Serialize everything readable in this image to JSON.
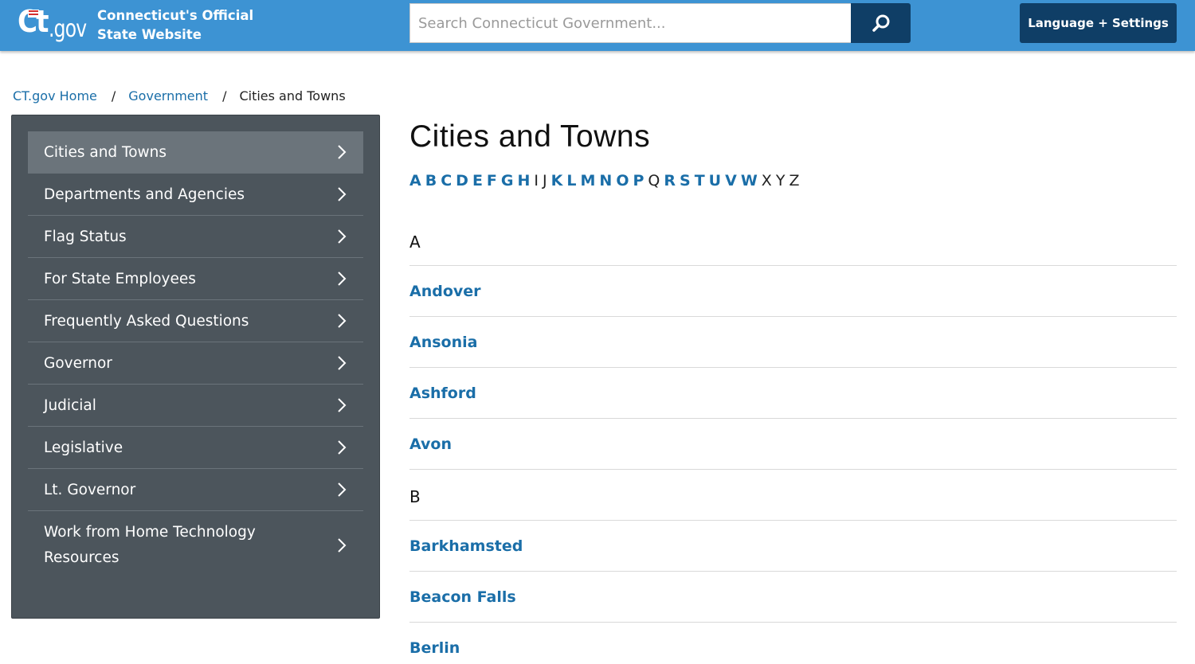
{
  "header": {
    "logo_ct": "Ct",
    "logo_gov": ".gov",
    "site_title_line1": "Connecticut's Official",
    "site_title_line2": "State Website",
    "search_placeholder": "Search Connecticut Government...",
    "search_icon": "search-icon",
    "language_button": "Language + Settings"
  },
  "breadcrumb": [
    {
      "label": "CT.gov Home"
    },
    {
      "label": "Government"
    },
    {
      "label": "Cities and Towns"
    }
  ],
  "breadcrumb_separator": "/",
  "sidebar": {
    "items": [
      {
        "label": "Cities and Towns"
      },
      {
        "label": "Departments and Agencies"
      },
      {
        "label": "Flag Status"
      },
      {
        "label": "For State Employees"
      },
      {
        "label": "Frequently Asked Questions"
      },
      {
        "label": "Governor"
      },
      {
        "label": "Judicial"
      },
      {
        "label": "Legislative"
      },
      {
        "label": "Lt. Governor"
      },
      {
        "label": "Work from Home Technology Resources"
      }
    ]
  },
  "main": {
    "title": "Cities and Towns",
    "alphabet": [
      {
        "letter": "A",
        "linked": true
      },
      {
        "letter": "B",
        "linked": true
      },
      {
        "letter": "C",
        "linked": true
      },
      {
        "letter": "D",
        "linked": true
      },
      {
        "letter": "E",
        "linked": true
      },
      {
        "letter": "F",
        "linked": true
      },
      {
        "letter": "G",
        "linked": true
      },
      {
        "letter": "H",
        "linked": true
      },
      {
        "letter": "I",
        "linked": false
      },
      {
        "letter": "J",
        "linked": false
      },
      {
        "letter": "K",
        "linked": true
      },
      {
        "letter": "L",
        "linked": true
      },
      {
        "letter": "M",
        "linked": true
      },
      {
        "letter": "N",
        "linked": true
      },
      {
        "letter": "O",
        "linked": true
      },
      {
        "letter": "P",
        "linked": true
      },
      {
        "letter": "Q",
        "linked": false
      },
      {
        "letter": "R",
        "linked": true
      },
      {
        "letter": "S",
        "linked": true
      },
      {
        "letter": "T",
        "linked": true
      },
      {
        "letter": "U",
        "linked": true
      },
      {
        "letter": "V",
        "linked": true
      },
      {
        "letter": "W",
        "linked": true
      },
      {
        "letter": "X",
        "linked": false
      },
      {
        "letter": "Y",
        "linked": false
      },
      {
        "letter": "Z",
        "linked": false
      }
    ],
    "sections": [
      {
        "letter": "A",
        "towns": [
          "Andover",
          "Ansonia",
          "Ashford",
          "Avon"
        ]
      },
      {
        "letter": "B",
        "towns": [
          "Barkhamsted",
          "Beacon Falls",
          "Berlin"
        ]
      }
    ]
  },
  "colors": {
    "header_bg": "#3d93d3",
    "dark_button": "#0f3e66",
    "sidebar_bg": "#4c555c",
    "sidebar_active": "#6b747b",
    "link": "#1a6ea8"
  }
}
